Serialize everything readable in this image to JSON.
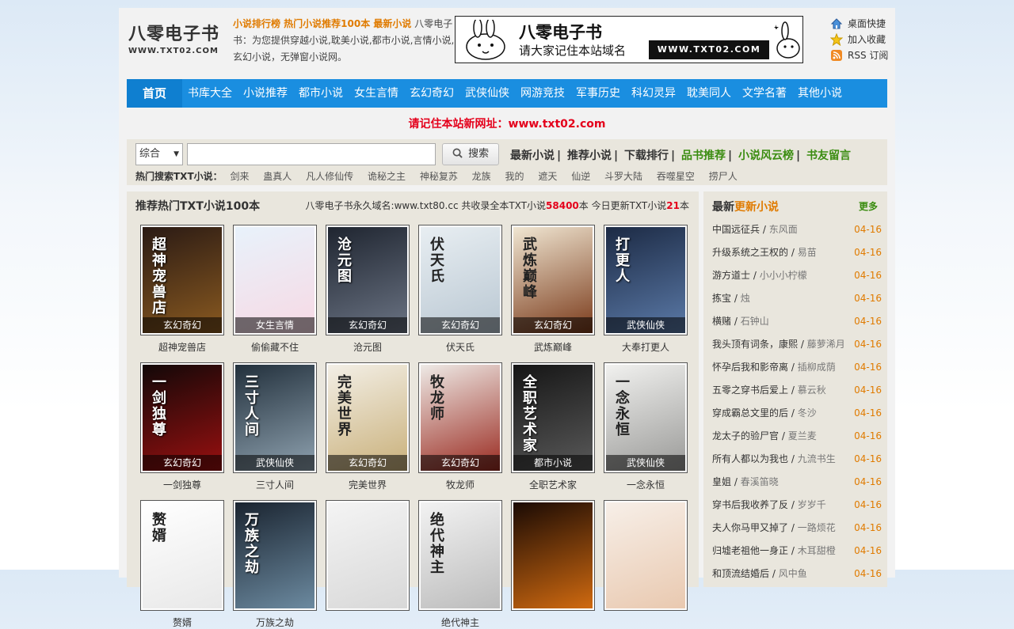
{
  "site": {
    "logo_cn": "八零电子书",
    "logo_en": "WWW.TXT02.COM",
    "intro_highlight": "小说排行榜 热门小说推荐100本 最新小说",
    "intro_text": "八零电子书：为您提供穿越小说,耽美小说,都市小说,言情小说,玄幻小说，无弹窗小说网。",
    "banner_title": "八零电子书",
    "banner_sub": "请大家记住本站域名",
    "banner_domain": "WWW.TXT02.COM",
    "quick_links": [
      "桌面快捷",
      "加入收藏",
      "RSS 订阅"
    ]
  },
  "nav": {
    "home": "首页",
    "items": [
      "书库大全",
      "小说推荐",
      "都市小说",
      "女生言情",
      "玄幻奇幻",
      "武侠仙侠",
      "网游竞技",
      "军事历史",
      "科幻灵异",
      "耽美同人",
      "文学名著",
      "其他小说"
    ]
  },
  "notice": "请记住本站新网址：www.txt02.com",
  "search": {
    "select_value": "综合",
    "input_value": "",
    "button": "搜索",
    "links": [
      "最新小说",
      "推荐小说",
      "下载排行",
      "品书推荐",
      "小说风云榜",
      "书友留言"
    ],
    "hot_label": "热门搜索TXT小说：",
    "hot_keywords": [
      "剑来",
      "蛊真人",
      "凡人修仙传",
      "诡秘之主",
      "神秘复苏",
      "龙族",
      "我的",
      "遮天",
      "仙逆",
      "斗罗大陆",
      "吞噬星空",
      "捞尸人"
    ]
  },
  "main": {
    "title": "推荐热门TXT小说100本",
    "stat_prefix": "八零电子书永久域名:www.txt80.cc 共收录全本TXT小说",
    "stat_total": "58400",
    "stat_mid": "本 今日更新TXT小说",
    "stat_today": "21",
    "stat_suffix": "本",
    "books": [
      {
        "name": "超神宠兽店",
        "cat": "玄幻奇幻",
        "cover_text": "超神宠兽店",
        "color1": "#2a1a14",
        "color2": "#8a5a20"
      },
      {
        "name": "偷偷藏不住",
        "cat": "女生言情",
        "cover_text": "",
        "color1": "#e8f2fb",
        "color2": "#f7d9e4"
      },
      {
        "name": "沧元图",
        "cat": "玄幻奇幻",
        "cover_text": "沧元图",
        "color1": "#1f2530",
        "color2": "#6b7484"
      },
      {
        "name": "伏天氏",
        "cat": "玄幻奇幻",
        "cover_text": "伏天氏",
        "color1": "#e8eef2",
        "color2": "#b9c7d2"
      },
      {
        "name": "武炼巅峰",
        "cat": "玄幻奇幻",
        "cover_text": "武炼巅峰",
        "color1": "#f0e6d2",
        "color2": "#7a3a1a"
      },
      {
        "name": "大奉打更人",
        "cat": "武侠仙侠",
        "cover_text": "打更人",
        "color1": "#1c2a44",
        "color2": "#5b7aa8"
      },
      {
        "name": "一剑独尊",
        "cat": "玄幻奇幻",
        "cover_text": "一剑独尊",
        "color1": "#120808",
        "color2": "#9a1010"
      },
      {
        "name": "三寸人间",
        "cat": "武侠仙侠",
        "cover_text": "三寸人间",
        "color1": "#22303c",
        "color2": "#8fa2b0"
      },
      {
        "name": "完美世界",
        "cat": "玄幻奇幻",
        "cover_text": "完美世界",
        "color1": "#f3efe6",
        "color2": "#c9b07a"
      },
      {
        "name": "牧龙师",
        "cat": "玄幻奇幻",
        "cover_text": "牧龙师",
        "color1": "#eeeae6",
        "color2": "#9a2a20"
      },
      {
        "name": "全职艺术家",
        "cat": "都市小说",
        "cover_text": "全职艺术家",
        "color1": "#151515",
        "color2": "#5a5a5a"
      },
      {
        "name": "一念永恒",
        "cat": "武侠仙侠",
        "cover_text": "一念永恒",
        "color1": "#f1f1ef",
        "color2": "#9a9a98"
      },
      {
        "name": "赘婿",
        "cat": "",
        "cover_text": "赘婿",
        "color1": "#ffffff",
        "color2": "#e8e8e8"
      },
      {
        "name": "万族之劫",
        "cat": "",
        "cover_text": "万族之劫",
        "color1": "#1a2430",
        "color2": "#6c8aa0"
      },
      {
        "name": "",
        "cat": "",
        "cover_text": "",
        "color1": "#f4f4f4",
        "color2": "#d8d8d8"
      },
      {
        "name": "绝代神主",
        "cat": "",
        "cover_text": "绝代神主",
        "color1": "#f2f2f2",
        "color2": "#bcbcbc"
      },
      {
        "name": "",
        "cat": "",
        "cover_text": "",
        "color1": "#1a0a04",
        "color2": "#d06a10"
      },
      {
        "name": "",
        "cat": "",
        "cover_text": "",
        "color1": "#f7efe8",
        "color2": "#e9c9b0"
      }
    ]
  },
  "side": {
    "title_a": "最新",
    "title_b": "更新小说",
    "more": "更多",
    "items": [
      {
        "title": "中国远征兵",
        "author": "东风面",
        "date": "04-16"
      },
      {
        "title": "升级系统之王权的",
        "author": "易苗",
        "date": "04-16"
      },
      {
        "title": "游方道士",
        "author": "小小小柠檬",
        "date": "04-16"
      },
      {
        "title": "拣宝",
        "author": "烛",
        "date": "04-16"
      },
      {
        "title": "横赌",
        "author": "石钟山",
        "date": "04-16"
      },
      {
        "title": "我头顶有词条，康熙",
        "author": "藤萝浠月",
        "date": "04-16"
      },
      {
        "title": "怀孕后我和影帝离",
        "author": "插柳成荫",
        "date": "04-16"
      },
      {
        "title": "五零之穿书后爱上",
        "author": "慕云秋",
        "date": "04-16"
      },
      {
        "title": "穿成霸总文里的后",
        "author": "冬沙",
        "date": "04-16"
      },
      {
        "title": "龙太子的验尸官",
        "author": "夏兰麦",
        "date": "04-16"
      },
      {
        "title": "所有人都以为我也",
        "author": "九流书生",
        "date": "04-16"
      },
      {
        "title": "皇姐",
        "author": "春溪笛晓",
        "date": "04-16"
      },
      {
        "title": "穿书后我收养了反",
        "author": "岁岁千",
        "date": "04-16"
      },
      {
        "title": "夫人你马甲又掉了",
        "author": "一路烦花",
        "date": "04-16"
      },
      {
        "title": "归墟老祖他一身正",
        "author": "木耳甜橙",
        "date": "04-16"
      },
      {
        "title": "和顶流结婚后",
        "author": "风中鱼",
        "date": "04-16"
      }
    ]
  },
  "colors": {
    "nav": "#1a8ee0",
    "accent_orange": "#e07b00",
    "accent_red": "#e4001b",
    "accent_green": "#3a8c10",
    "panel": "#e9e6dd"
  }
}
